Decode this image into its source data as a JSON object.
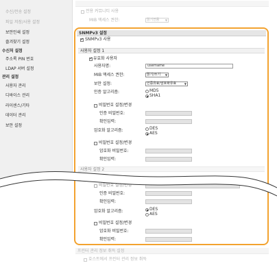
{
  "sidebar": {
    "items_top": [
      "수신/전송 설정",
      "파일 저장/사용 설정",
      "보안인쇄 설정",
      "즐겨찾기 설정"
    ],
    "destination_group": {
      "title": "수신처 설정",
      "items": [
        "주소록 PIN 번호",
        "LDAP 서버 설정"
      ]
    },
    "management_group": {
      "title": "관리 설정",
      "items": [
        "사용자 관리",
        "디바이스 관리",
        "라이센스/기타",
        "데이터 관리",
        "보안 설정"
      ]
    }
  },
  "snmpv1_tail": {
    "dedicated_community_label": "전용 커뮤니티 사용",
    "dedicated_community_checked": false,
    "mib_access_label": "MIB 액세스 권한:",
    "mib_access_value": "읽기전용"
  },
  "snmpv3": {
    "title": "SNMPv3 설정",
    "enable_label": "SNMPv3 사용",
    "enable_checked": true,
    "user1": {
      "title": "사용자 설정 1",
      "enable_label": "유효화 사용자",
      "enable_checked": true,
      "username_label": "사용자명:",
      "username_value": "username",
      "mib_label": "MIB 액세스 권한:",
      "mib_value": "읽기/쓰기",
      "security_label": "보안 설정:",
      "security_value": "인증유효/암호화유효",
      "auth_algo_label": "인증 알고리즘:",
      "auth_algo_options": [
        "MD5",
        "SHA1"
      ],
      "auth_algo_selected": "SHA1",
      "auth_pw_change_label": "비밀번호 설정/변경",
      "auth_pw_change_checked": false,
      "auth_pw_label": "인증 비밀번호:",
      "auth_pw_confirm_label": "확인입력:",
      "enc_algo_label": "암호화 알고리즘:",
      "enc_algo_options": [
        "DES",
        "AES"
      ],
      "enc_algo_selected": "AES",
      "enc_pw_change_label": "비밀번호 설정/변경",
      "enc_pw_change_checked": false,
      "enc_pw_label": "암호화 비밀번호:",
      "enc_pw_confirm_label": "확인입력:"
    },
    "user2": {
      "title": "사용자 설정 2",
      "auth_pw_change_label": "비밀번호 설정/변경",
      "auth_pw_change_checked": false,
      "auth_pw_label": "인증 비밀번호:",
      "auth_pw_confirm_label": "확인입력:",
      "enc_algo_label": "암호화 알고리즘:",
      "enc_algo_options": [
        "DES",
        "AES"
      ],
      "enc_algo_selected": "DES",
      "enc_pw_change_label": "비밀번호 설정/변경",
      "enc_pw_change_checked": false,
      "enc_pw_label": "암호화 비밀번호:",
      "enc_pw_confirm_label": "확인입력:"
    }
  },
  "printer_mgmt": {
    "title": "프린터 관리 정보 취득 설정",
    "host_label": "호스트에서 프린터 관리 정보 취득",
    "host_checked": false
  },
  "colors": {
    "highlight": "#f3a22e",
    "sidebar_bg": "#f0f0f0",
    "header_bg": "#e6e6e6"
  }
}
